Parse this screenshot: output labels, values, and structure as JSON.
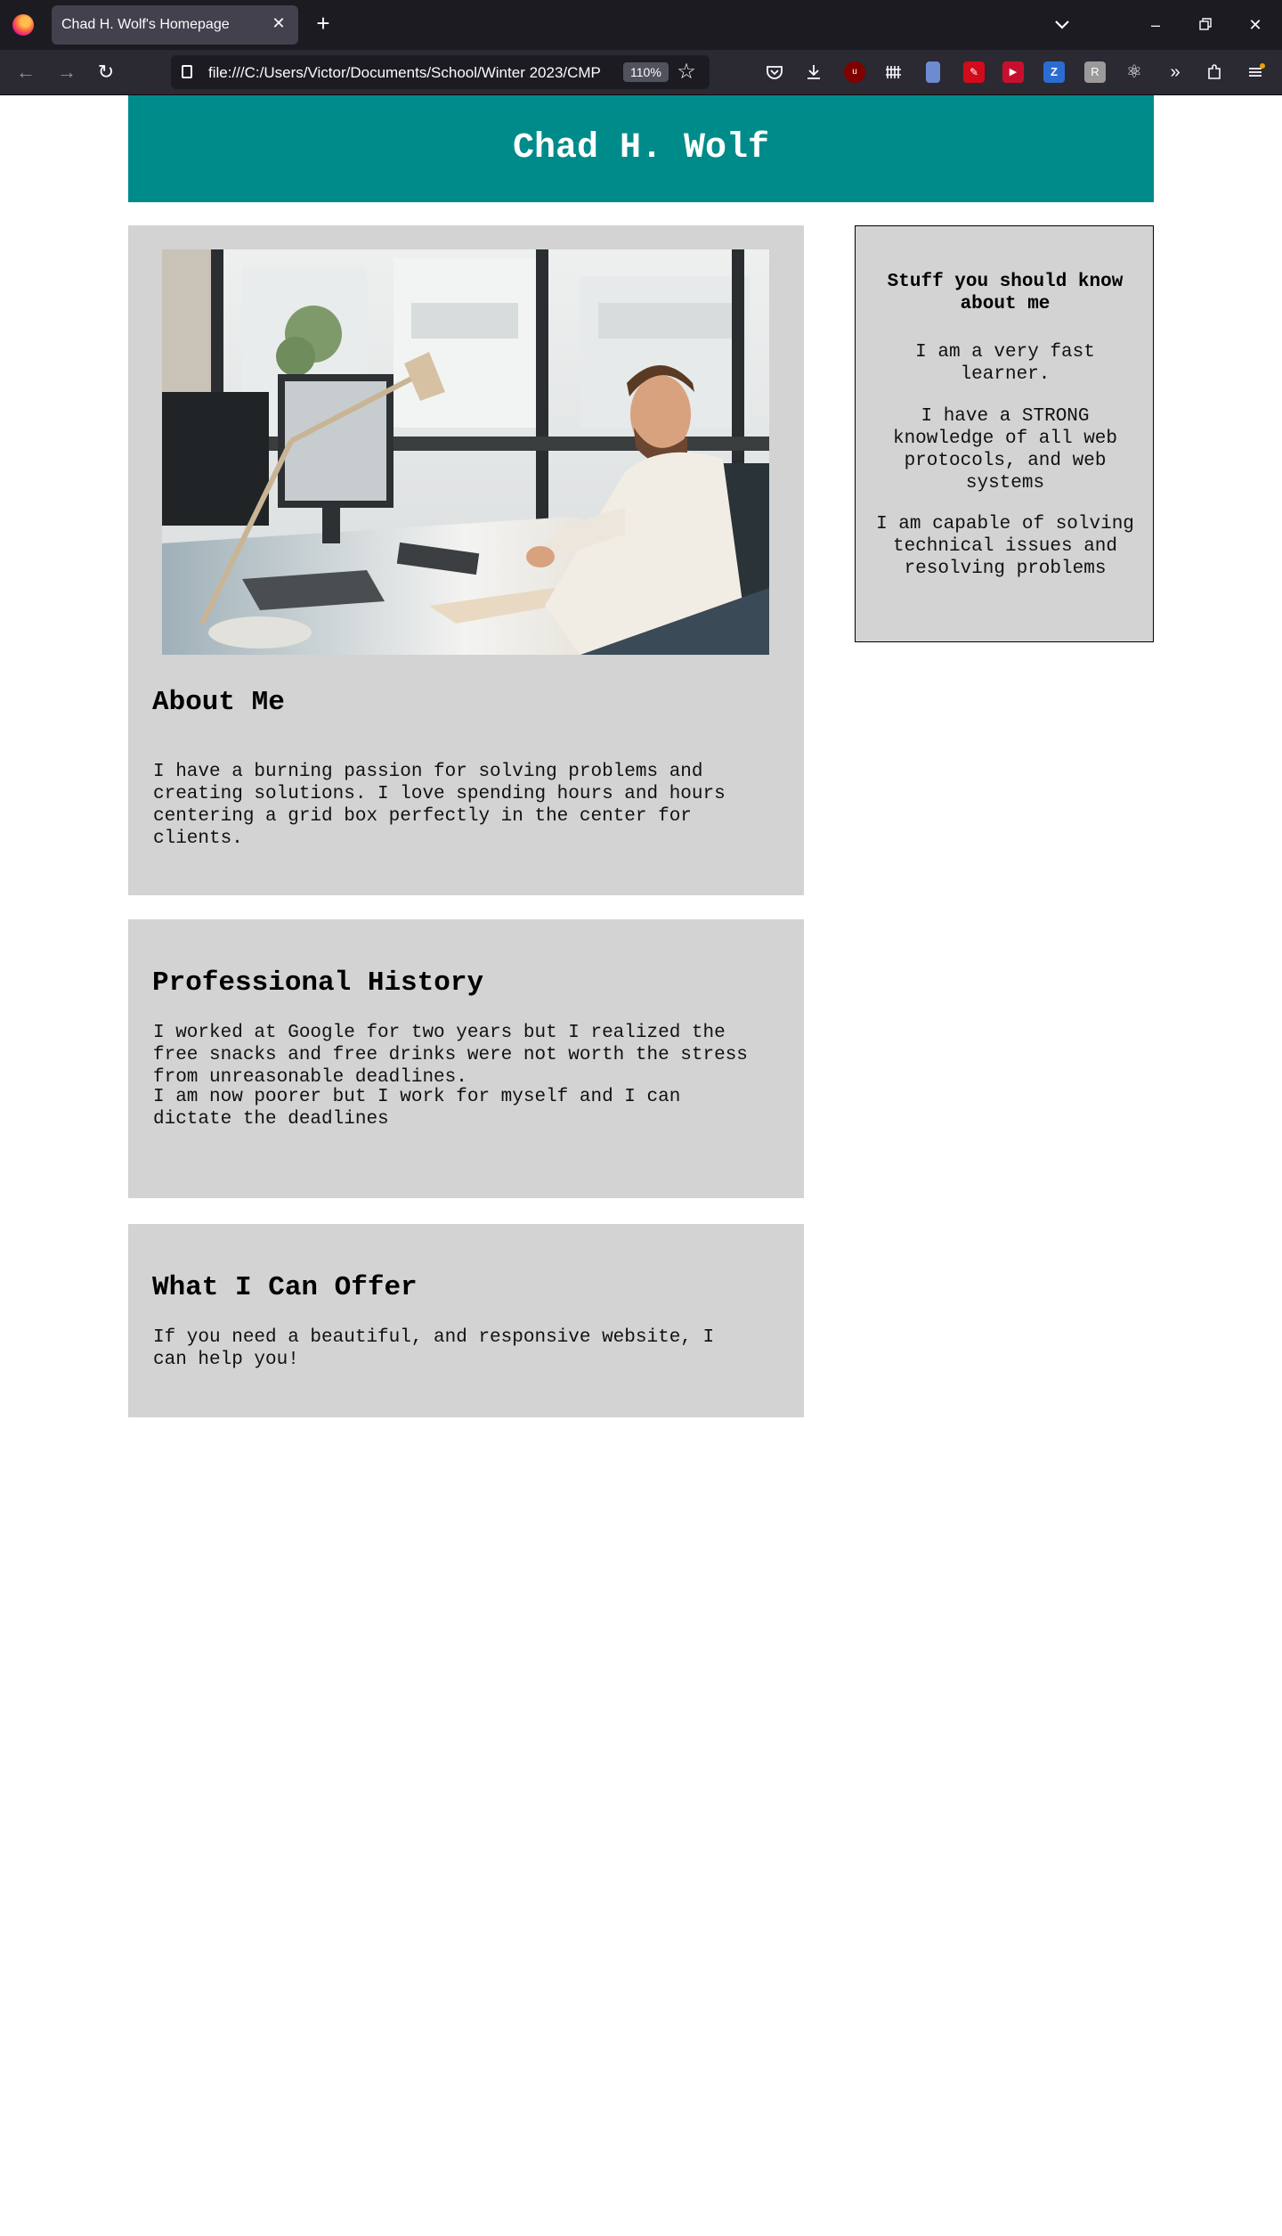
{
  "browser": {
    "tab_title": "Chad H. Wolf's Homepage",
    "url": "file:///C:/Users/Victor/Documents/School/Winter 2023/CMP",
    "zoom": "110%",
    "toolbar_icons": [
      "pocket-icon",
      "download-icon",
      "ublock-icon",
      "extension-grid-icon",
      "bookmark-ext-icon",
      "pdf-ext-icon",
      "video-ext-icon",
      "zotero-icon",
      "ext-r-icon",
      "react-devtools-icon",
      "overflow-icon",
      "extensions-icon",
      "menu-icon"
    ]
  },
  "header": {
    "title": "Chad H. Wolf"
  },
  "about": {
    "heading": "About Me",
    "text": "I have a burning passion for solving problems and creating solutions. I love spending hours and hours centering a grid box perfectly in the center for clients."
  },
  "history": {
    "heading": "Professional History",
    "para1": "I worked at Google for two years but I realized the free snacks and free drinks were not worth the stress from unreasonable deadlines.",
    "para2": "I am now poorer but I work for myself and I can dictate the deadlines"
  },
  "offer": {
    "heading": "What I Can Offer",
    "text": "If you need a beautiful, and responsive website, I can help you!"
  },
  "sidebar": {
    "heading": "Stuff you should know about me",
    "items": [
      "I am a very fast learner.",
      "I have a STRONG knowledge of all web protocols, and web systems",
      "I am capable of solving technical issues and resolving problems"
    ]
  },
  "colors": {
    "header_bg": "#008b8b",
    "card_bg": "#d3d3d3",
    "chrome_bg": "#1c1b22"
  }
}
